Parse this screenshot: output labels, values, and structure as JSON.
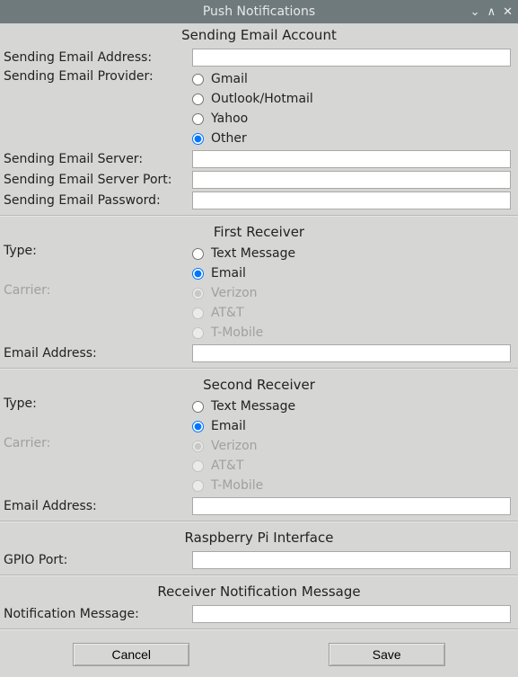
{
  "window": {
    "title": "Push Notifications"
  },
  "sections": {
    "sending": {
      "header": "Sending Email Account",
      "address_label": "Sending Email Address:",
      "address_value": "",
      "provider_label": "Sending Email Provider:",
      "providers": {
        "gmail": "Gmail",
        "outlook": "Outlook/Hotmail",
        "yahoo": "Yahoo",
        "other": "Other"
      },
      "provider_selected": "other",
      "server_label": "Sending Email Server:",
      "server_value": "",
      "port_label": "Sending Email Server Port:",
      "port_value": "",
      "password_label": "Sending Email Password:",
      "password_value": ""
    },
    "first_receiver": {
      "header": "First Receiver",
      "type_label": "Type:",
      "types": {
        "text": "Text Message",
        "email": "Email"
      },
      "type_selected": "email",
      "carrier_label": "Carrier:",
      "carriers": {
        "verizon": "Verizon",
        "att": "AT&T",
        "tmobile": "T-Mobile"
      },
      "email_label": "Email Address:",
      "email_value": ""
    },
    "second_receiver": {
      "header": "Second Receiver",
      "type_label": "Type:",
      "types": {
        "text": "Text Message",
        "email": "Email"
      },
      "type_selected": "email",
      "carrier_label": "Carrier:",
      "carriers": {
        "verizon": "Verizon",
        "att": "AT&T",
        "tmobile": "T-Mobile"
      },
      "email_label": "Email Address:",
      "email_value": ""
    },
    "rpi": {
      "header": "Raspberry Pi Interface",
      "gpio_label": "GPIO Port:",
      "gpio_value": ""
    },
    "notification": {
      "header": "Receiver Notification Message",
      "message_label": "Notification Message:",
      "message_value": ""
    }
  },
  "buttons": {
    "cancel": "Cancel",
    "save": "Save"
  }
}
